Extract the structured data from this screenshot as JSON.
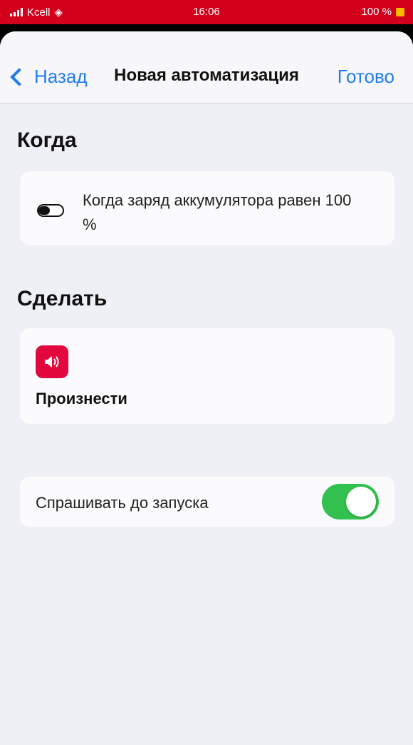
{
  "status_bar": {
    "carrier": "Kcell",
    "time": "16:06",
    "battery_percent": "100 %"
  },
  "nav": {
    "back_label": "Назад",
    "title": "Новая автоматизация",
    "done_label": "Готово"
  },
  "when_section": {
    "title": "Когда",
    "trigger_text": "Когда заряд аккумулятора равен 100 %"
  },
  "do_section": {
    "title": "Сделать",
    "action_label": "Произнести",
    "action_icon": "speaker-icon"
  },
  "settings": {
    "ask_before_run_label": "Спрашивать до запуска",
    "ask_before_run_enabled": true
  },
  "colors": {
    "status_bar_bg": "#d3001c",
    "accent_blue": "#1f7cf2",
    "action_icon_bg": "#e2083e",
    "toggle_on": "#32c14f",
    "background": "#eef0f5"
  }
}
